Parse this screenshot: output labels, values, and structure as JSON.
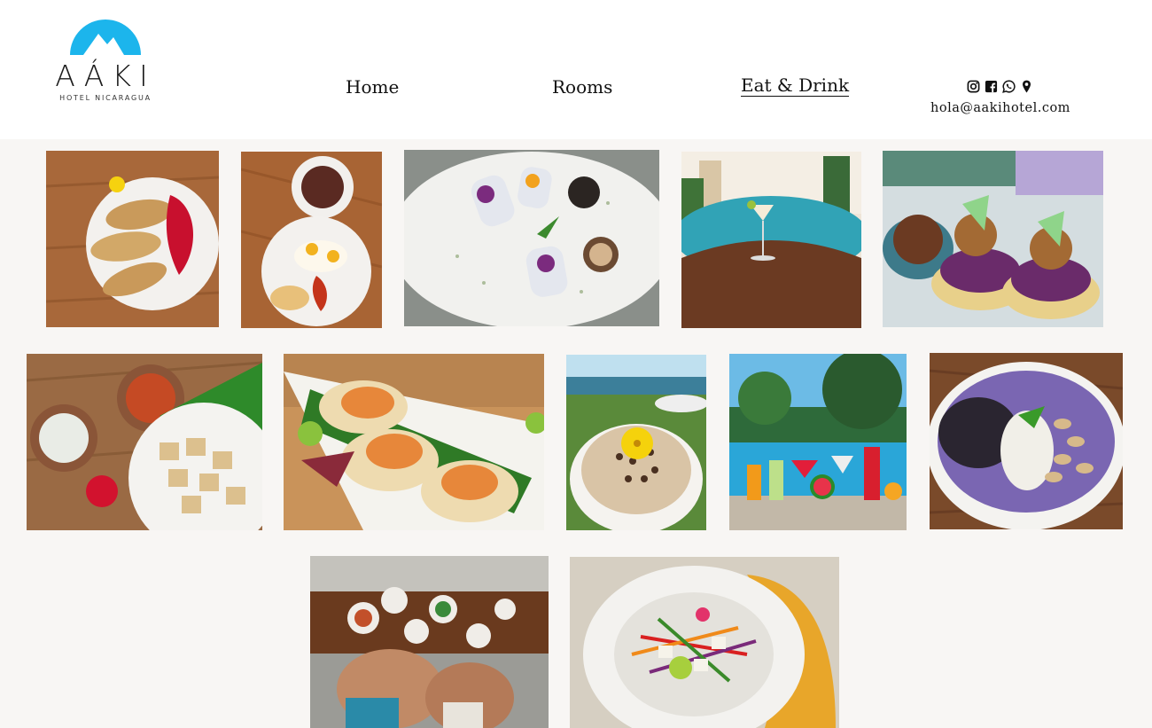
{
  "brand": {
    "name": "AÁKI",
    "tagline": "HOTEL NICARAGUA",
    "color": "#1cb5ec"
  },
  "nav": {
    "items": [
      {
        "label": "Home",
        "active": false
      },
      {
        "label": "Rooms",
        "active": false
      },
      {
        "label": "Eat & Drink",
        "active": true
      }
    ]
  },
  "contact": {
    "email": "hola@aakihotel.com",
    "icons": [
      "instagram-icon",
      "facebook-icon",
      "whatsapp-icon",
      "map-pin-icon"
    ]
  },
  "gallery": {
    "photos": [
      {
        "name": "french-toast-photo"
      },
      {
        "name": "breakfast-eggs-photo"
      },
      {
        "name": "spring-rolls-photo"
      },
      {
        "name": "poolside-cocktail-photo"
      },
      {
        "name": "purple-tacos-photo"
      },
      {
        "name": "yuca-fries-photo"
      },
      {
        "name": "fish-tacos-photo"
      },
      {
        "name": "smoothie-bowl-photo"
      },
      {
        "name": "pool-drinks-photo"
      },
      {
        "name": "acai-bowl-photo"
      },
      {
        "name": "group-table-photo"
      },
      {
        "name": "ceviche-photo"
      }
    ]
  }
}
